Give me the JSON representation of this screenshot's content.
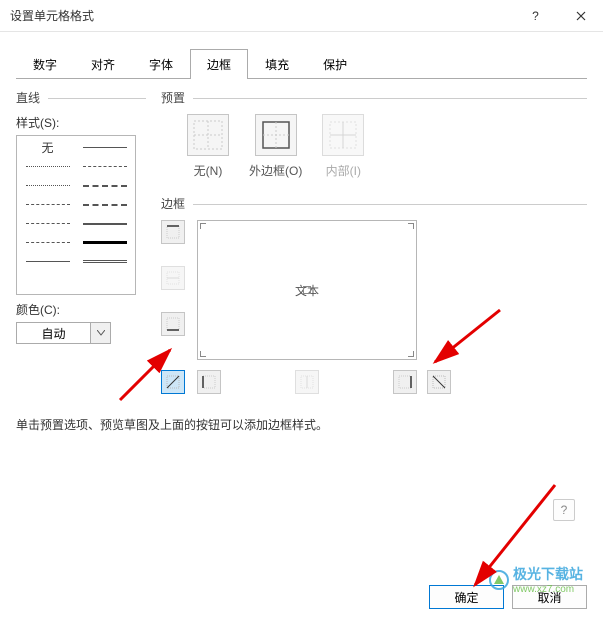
{
  "window": {
    "title": "设置单元格格式"
  },
  "tabs": [
    "数字",
    "对齐",
    "字体",
    "边框",
    "填充",
    "保护"
  ],
  "active_tab_index": 3,
  "line": {
    "group": "直线",
    "style_label": "样式(S):",
    "none_label": "无",
    "color_label": "颜色(C):",
    "color_value": "自动"
  },
  "preset": {
    "group": "预置",
    "items": [
      {
        "label": "无(N)"
      },
      {
        "label": "外边框(O)"
      },
      {
        "label": "内部(I)",
        "disabled": true
      }
    ]
  },
  "border": {
    "group": "边框",
    "preview_text": "文本"
  },
  "hint": "单击预置选项、预览草图及上面的按钮可以添加边框样式。",
  "footer": {
    "ok": "确定",
    "cancel": "取消"
  },
  "watermark": {
    "text1": "极光下载站",
    "text2": "www.xz7.com"
  },
  "help": "?"
}
